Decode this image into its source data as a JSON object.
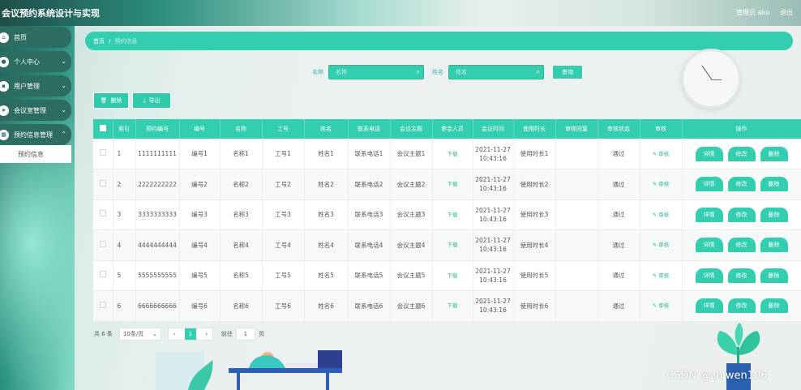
{
  "app": {
    "title": "会议预约系统设计与实现",
    "user_label": "管理员 abo",
    "logout": "退出"
  },
  "sidebar": {
    "items": [
      {
        "label": "首页",
        "icon": "home-icon",
        "expandable": false
      },
      {
        "label": "个人中心",
        "icon": "user-icon",
        "expandable": true
      },
      {
        "label": "用户管理",
        "icon": "users-icon",
        "expandable": true
      },
      {
        "label": "会议室管理",
        "icon": "rocket-icon",
        "expandable": true
      },
      {
        "label": "预约信息管理",
        "icon": "calendar-icon",
        "expandable": true
      }
    ],
    "sub_items": [
      {
        "label": "预约信息"
      }
    ]
  },
  "breadcrumb": {
    "home": "首页",
    "sep": "/",
    "current": "预约信息"
  },
  "search": {
    "name_label": "名称",
    "name_placeholder": "名称",
    "person_label": "姓名",
    "person_placeholder": "姓名",
    "query_button": "查询"
  },
  "toolbar": {
    "delete_label": "删除",
    "export_label": "导出"
  },
  "table": {
    "headers": [
      "",
      "索引",
      "预约编号",
      "编号",
      "名称",
      "工号",
      "姓名",
      "联系电话",
      "会议主题",
      "参会人员",
      "会议时间",
      "使用时长",
      "审核回复",
      "审核状态",
      "审核",
      "操作"
    ],
    "rows": [
      {
        "index": "1",
        "booking_no": "1111111111",
        "code": "编号1",
        "name": "名称1",
        "job_no": "工号1",
        "person": "姓名1",
        "phone": "联系电话1",
        "topic": "会议主题1",
        "attendees": "下载",
        "time": "2021-11-27 10:43:16",
        "duration": "使用时长1",
        "reply": "",
        "status": "通过",
        "audit": "审核"
      },
      {
        "index": "2",
        "booking_no": "2222222222",
        "code": "编号2",
        "name": "名称2",
        "job_no": "工号2",
        "person": "姓名2",
        "phone": "联系电话2",
        "topic": "会议主题2",
        "attendees": "下载",
        "time": "2021-11-27 10:43:16",
        "duration": "使用时长2",
        "reply": "",
        "status": "通过",
        "audit": "审核"
      },
      {
        "index": "3",
        "booking_no": "3333333333",
        "code": "编号3",
        "name": "名称3",
        "job_no": "工号3",
        "person": "姓名3",
        "phone": "联系电话3",
        "topic": "会议主题3",
        "attendees": "下载",
        "time": "2021-11-27 10:43:16",
        "duration": "使用时长3",
        "reply": "",
        "status": "通过",
        "audit": "审核"
      },
      {
        "index": "4",
        "booking_no": "4444444444",
        "code": "编号4",
        "name": "名称4",
        "job_no": "工号4",
        "person": "姓名4",
        "phone": "联系电话4",
        "topic": "会议主题4",
        "attendees": "下载",
        "time": "2021-11-27 10:43:16",
        "duration": "使用时长4",
        "reply": "",
        "status": "通过",
        "audit": "审核"
      },
      {
        "index": "5",
        "booking_no": "5555555555",
        "code": "编号5",
        "name": "名称5",
        "job_no": "工号5",
        "person": "姓名5",
        "phone": "联系电话5",
        "topic": "会议主题5",
        "attendees": "下载",
        "time": "2021-11-27 10:43:16",
        "duration": "使用时长5",
        "reply": "",
        "status": "通过",
        "audit": "审核"
      },
      {
        "index": "6",
        "booking_no": "6666666666",
        "code": "编号6",
        "name": "名称6",
        "job_no": "工号6",
        "person": "姓名6",
        "phone": "联系电话6",
        "topic": "会议主题6",
        "attendees": "下载",
        "time": "2021-11-27 10:43:16",
        "duration": "使用时长6",
        "reply": "",
        "status": "通过",
        "audit": "审核"
      }
    ],
    "row_actions": {
      "detail": "详情",
      "edit": "修改",
      "delete": "删除"
    }
  },
  "pagination": {
    "total": "共 6 条",
    "page_size": "10条/页",
    "current_page": "1",
    "goto_label": "前往",
    "goto_value": "1",
    "page_suffix": "页"
  },
  "watermark": "CSDN @zhiwen106",
  "colors": {
    "accent": "#33cdb0",
    "sidebar": "#2d6c63"
  }
}
